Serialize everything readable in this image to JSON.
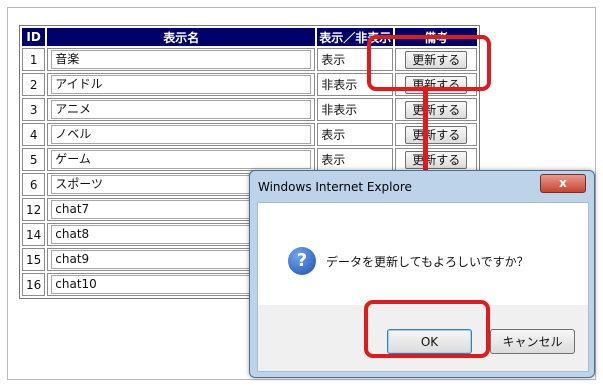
{
  "table": {
    "headers": {
      "id": "ID",
      "name": "表示名",
      "visibility": "表示／非表示",
      "notes": "備考"
    },
    "update_label": "更新する",
    "rows": [
      {
        "id": "1",
        "name": "音楽",
        "visibility": "表示"
      },
      {
        "id": "2",
        "name": "アイドル",
        "visibility": "非表示"
      },
      {
        "id": "3",
        "name": "アニメ",
        "visibility": "非表示"
      },
      {
        "id": "4",
        "name": "ノベル",
        "visibility": "表示"
      },
      {
        "id": "5",
        "name": "ゲーム",
        "visibility": "表示"
      },
      {
        "id": "6",
        "name": "スポーツ",
        "visibility": ""
      },
      {
        "id": "12",
        "name": "chat7",
        "visibility": ""
      },
      {
        "id": "14",
        "name": "chat8",
        "visibility": ""
      },
      {
        "id": "15",
        "name": "chat9",
        "visibility": ""
      },
      {
        "id": "16",
        "name": "chat10",
        "visibility": ""
      }
    ]
  },
  "dialog": {
    "title": "Windows Internet Explore",
    "close_label": "x",
    "icon": "question-icon",
    "message": "データを更新してもよろしいですか？",
    "ok_label": "OK",
    "cancel_label": "キャンセル"
  },
  "colors": {
    "header_bg": "#00006b",
    "highlight": "#e11b1b"
  }
}
